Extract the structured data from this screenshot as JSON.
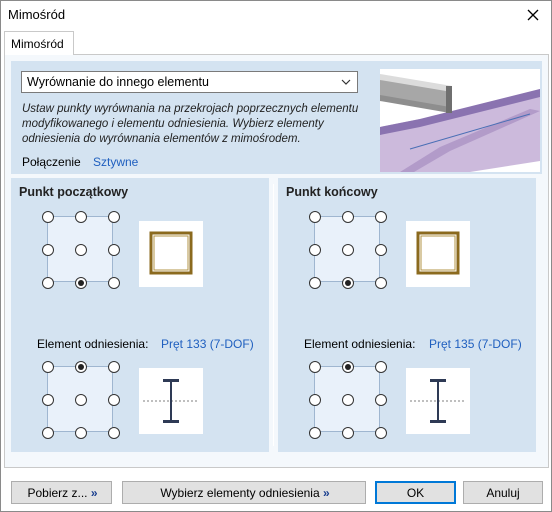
{
  "window": {
    "title": "Mimośród"
  },
  "tab": {
    "label": "Mimośród"
  },
  "dropdown": {
    "selected": "Wyrównanie do innego elementu"
  },
  "description": "Ustaw punkty wyrównania na przekrojach poprzecznych elementu modyfikowanego i elementu odniesienia. Wybierz elementy odniesienia do wyrównania elementów z mimośrodem.",
  "connection": {
    "label": "Połączenie",
    "value": "Sztywne"
  },
  "start": {
    "title": "Punkt początkowy",
    "member_selected": 7,
    "ref_label": "Element odniesienia:",
    "ref_value": "Pręt 133 (7-DOF)",
    "ref_selected": 1
  },
  "end": {
    "title": "Punkt końcowy",
    "member_selected": 7,
    "ref_label": "Element odniesienia:",
    "ref_value": "Pręt 135 (7-DOF)",
    "ref_selected": 1
  },
  "buttons": {
    "fetch": "Pobierz z...",
    "select_refs": "Wybierz elementy odniesienia",
    "ok": "OK",
    "cancel": "Anuluj",
    "chevron": "»"
  },
  "colors": {
    "panel": "#d4e3f1",
    "link": "#1f5fbf",
    "section_box": "#8b6a1e",
    "beam": "#c7b2d8"
  }
}
